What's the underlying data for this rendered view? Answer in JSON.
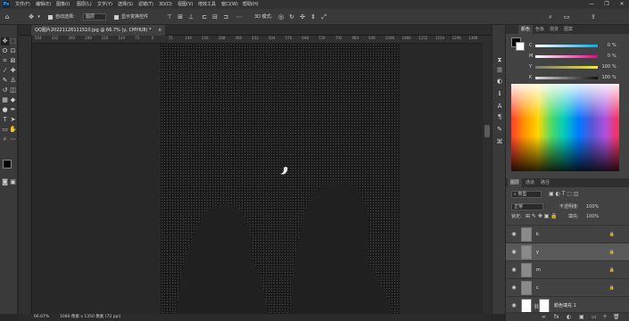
{
  "menubar": {
    "logo": "Ps",
    "items": [
      "文件(F)",
      "编辑(E)",
      "图像(I)",
      "图层(L)",
      "文字(Y)",
      "选择(S)",
      "滤镜(T)",
      "3D(D)",
      "视图(V)",
      "增效工具",
      "窗口(W)",
      "帮助(H)"
    ],
    "window_controls": [
      "—",
      "❐",
      "✕"
    ]
  },
  "optionsbar": {
    "auto_select_label": "自动选择:",
    "auto_select_value": "图层",
    "show_transform_label": "显示变换控件",
    "mode_3d_label": "3D 模式:"
  },
  "document": {
    "tab_title": "QQ图片20221126111510.jpg @ 66.7% (y, CMYK/8) *",
    "tab_close": "×",
    "ruler_ticks": [
      "504",
      "432",
      "360",
      "288",
      "216",
      "144",
      "72",
      "0",
      "72",
      "144",
      "216",
      "288",
      "360",
      "432",
      "504",
      "576",
      "648",
      "720",
      "792",
      "864",
      "936",
      "1008",
      "1080",
      "1152",
      "1224",
      "1296",
      "1368"
    ],
    "status_zoom": "66.67%",
    "status_info": "1080 像素 x 1350 像素 (72 ppi)"
  },
  "panels": {
    "color_tabs": [
      "颜色",
      "色板",
      "渐变",
      "图案"
    ],
    "color_sliders": [
      {
        "label": "C",
        "value": "0",
        "track": "#26c6da"
      },
      {
        "label": "M",
        "value": "0",
        "track": "#e040fb"
      },
      {
        "label": "Y",
        "value": "100",
        "track": "#eeee22"
      },
      {
        "label": "K",
        "value": "100",
        "track": "#888888"
      }
    ],
    "percent": "%",
    "layers_tabs": [
      "图层",
      "通道",
      "路径"
    ],
    "kind_filter": "类型",
    "blend_mode": "正常",
    "opacity_label": "不透明度:",
    "opacity_value": "100%",
    "lock_label": "锁定:",
    "fill_label": "填充:",
    "fill_value": "100%",
    "layers": [
      {
        "name": "k",
        "selected": false
      },
      {
        "name": "y",
        "selected": true
      },
      {
        "name": "m",
        "selected": false
      },
      {
        "name": "c",
        "selected": false
      },
      {
        "name": "颜色填充 1",
        "selected": false
      }
    ],
    "bottom_icons": [
      "∞",
      "fx",
      "◐",
      "▣",
      "▭",
      "＋",
      "🗑"
    ]
  },
  "colors": {
    "foreground": "#000000",
    "background": "#ffffff",
    "selected_layer": "#595959"
  }
}
